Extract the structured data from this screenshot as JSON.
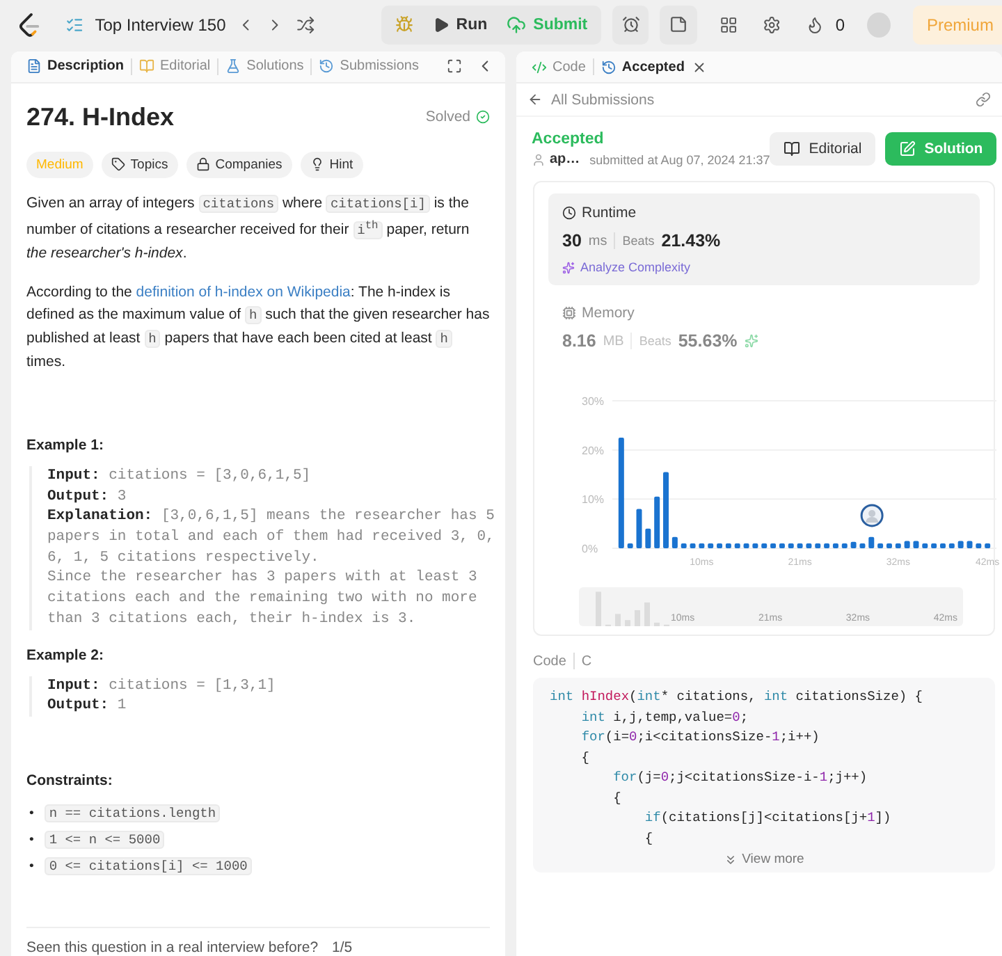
{
  "topbar": {
    "list_title": "Top Interview 150",
    "run": "Run",
    "submit": "Submit",
    "streak": "0",
    "premium": "Premium"
  },
  "left_tabs": [
    {
      "label": "Description",
      "selected": true,
      "kind": "description"
    },
    {
      "label": "Editorial",
      "selected": false,
      "kind": "editorial"
    },
    {
      "label": "Solutions",
      "selected": false,
      "kind": "solutions"
    },
    {
      "label": "Submissions",
      "selected": false,
      "kind": "submissions"
    }
  ],
  "problem": {
    "title": "274. H-Index",
    "status": "Solved",
    "difficulty": "Medium",
    "tags": [
      {
        "kind": "topics",
        "label": "Topics"
      },
      {
        "kind": "companies",
        "label": "Companies"
      },
      {
        "kind": "hint",
        "label": "Hint"
      }
    ],
    "paragraphs": [
      [
        {
          "kind": "text",
          "text": "Given an array of integers "
        },
        {
          "kind": "code",
          "text": "citations"
        },
        {
          "kind": "text",
          "text": " where "
        },
        {
          "kind": "code",
          "text": "citations[i]"
        },
        {
          "kind": "text",
          "text": " is the number of citations a researcher received for their "
        },
        {
          "kind": "code",
          "text": "i$^{th}$"
        },
        {
          "kind": "text",
          "text": " paper, return "
        },
        {
          "kind": "em",
          "text": "the researcher's h-index"
        },
        {
          "kind": "text",
          "text": "."
        }
      ],
      [
        {
          "kind": "text",
          "text": "According to the "
        },
        {
          "kind": "link",
          "text": "definition of h-index on Wikipedia"
        },
        {
          "kind": "text",
          "text": ": The h-index is defined as the maximum value of "
        },
        {
          "kind": "code",
          "text": "h"
        },
        {
          "kind": "text",
          "text": " such that the given researcher has published at least "
        },
        {
          "kind": "code",
          "text": "h"
        },
        {
          "kind": "text",
          "text": " papers that have each been cited at least "
        },
        {
          "kind": "code",
          "text": "h"
        },
        {
          "kind": "text",
          "text": " times."
        }
      ]
    ],
    "examples": [
      {
        "heading": "Example 1:",
        "lines": [
          {
            "label": "Input:",
            "value": "citations = [3,0,6,1,5]"
          },
          {
            "label": "Output:",
            "value": "3"
          },
          {
            "label": "Explanation:",
            "value": "[3,0,6,1,5] means the researcher has 5\npapers in total and each of them had received 3, 0,\n6, 1, 5 citations respectively.\nSince the researcher has 3 papers with at least 3\ncitations each and the remaining two with no more\nthan 3 citations each, their h-index is 3."
          }
        ]
      },
      {
        "heading": "Example 2:",
        "lines": [
          {
            "label": "Input:",
            "value": "citations = [1,3,1]"
          },
          {
            "label": "Output:",
            "value": "1"
          }
        ]
      }
    ],
    "constraints_heading": "Constraints:",
    "bullet": "•",
    "constraints": [
      "n == citations.length",
      "1 <= n <= 5000",
      "0 <= citations[i] <= 1000"
    ],
    "footer": "Seen this question in a real interview before?",
    "footer_count": "1/5"
  },
  "right_tabs": [
    {
      "label": "Code",
      "selected": false,
      "kind": "code"
    },
    {
      "label": "Accepted",
      "selected": true,
      "kind": "result"
    }
  ],
  "submission": {
    "back": "All Submissions",
    "status": "Accepted",
    "user": "ap…",
    "submitted": "submitted at Aug 07, 2024 21:37",
    "editorial": "Editorial",
    "solution": "Solution",
    "stats": [
      {
        "kind": "runtime",
        "label": "Runtime",
        "value": "30",
        "unit": "ms",
        "beats_label": "Beats",
        "beats": "21.43%",
        "action": "Analyze Complexity",
        "selected": true
      },
      {
        "kind": "memory",
        "label": "Memory",
        "value": "8.16",
        "unit": "MB",
        "beats_label": "Beats",
        "beats": "55.63%",
        "selected": false
      }
    ],
    "chart_data": {
      "type": "bar",
      "x": [
        1,
        2,
        3,
        4,
        5,
        6,
        7,
        8,
        9,
        10,
        11,
        12,
        13,
        14,
        15,
        16,
        17,
        18,
        19,
        20,
        21,
        22,
        23,
        24,
        25,
        26,
        27,
        28,
        29,
        30,
        31,
        32,
        33,
        34,
        35,
        36,
        37,
        38,
        39,
        40,
        41,
        42
      ],
      "values": [
        22.5,
        1,
        8,
        4,
        10.5,
        15.5,
        2.3,
        1,
        1,
        1,
        1,
        1,
        1,
        1,
        1,
        1,
        1,
        1,
        1,
        1,
        1,
        1,
        1,
        1,
        1,
        1,
        1.3,
        1,
        2.3,
        1,
        1,
        1,
        1.5,
        1.5,
        1,
        1,
        1,
        1,
        1.5,
        1.5,
        1,
        1
      ],
      "ylim": [
        0,
        30
      ],
      "yticks": [
        {
          "value": 0,
          "label": "0%"
        },
        {
          "value": 10,
          "label": "10%"
        },
        {
          "value": 20,
          "label": "20%"
        },
        {
          "value": 30,
          "label": "30%"
        }
      ],
      "xlim": [
        0,
        43
      ],
      "xticks": [
        {
          "value": 10,
          "label": "10ms"
        },
        {
          "value": 21,
          "label": "21ms"
        },
        {
          "value": 32,
          "label": "32ms"
        },
        {
          "value": 42,
          "label": "42ms"
        }
      ]
    },
    "overview_labels": [
      "10ms",
      "21ms",
      "32ms",
      "42ms"
    ],
    "code_label": "Code",
    "language": "C",
    "code": [
      "int hIndex(int* citations, int citationsSize) {",
      "    int i,j,temp,value=0;",
      "    for(i=0;i<citationsSize-1;i++)",
      "    {",
      "        for(j=0;j<citationsSize-i-1;j++)",
      "        {",
      "            if(citations[j]<citations[j+1])",
      "            {"
    ],
    "view_more": "View more"
  }
}
